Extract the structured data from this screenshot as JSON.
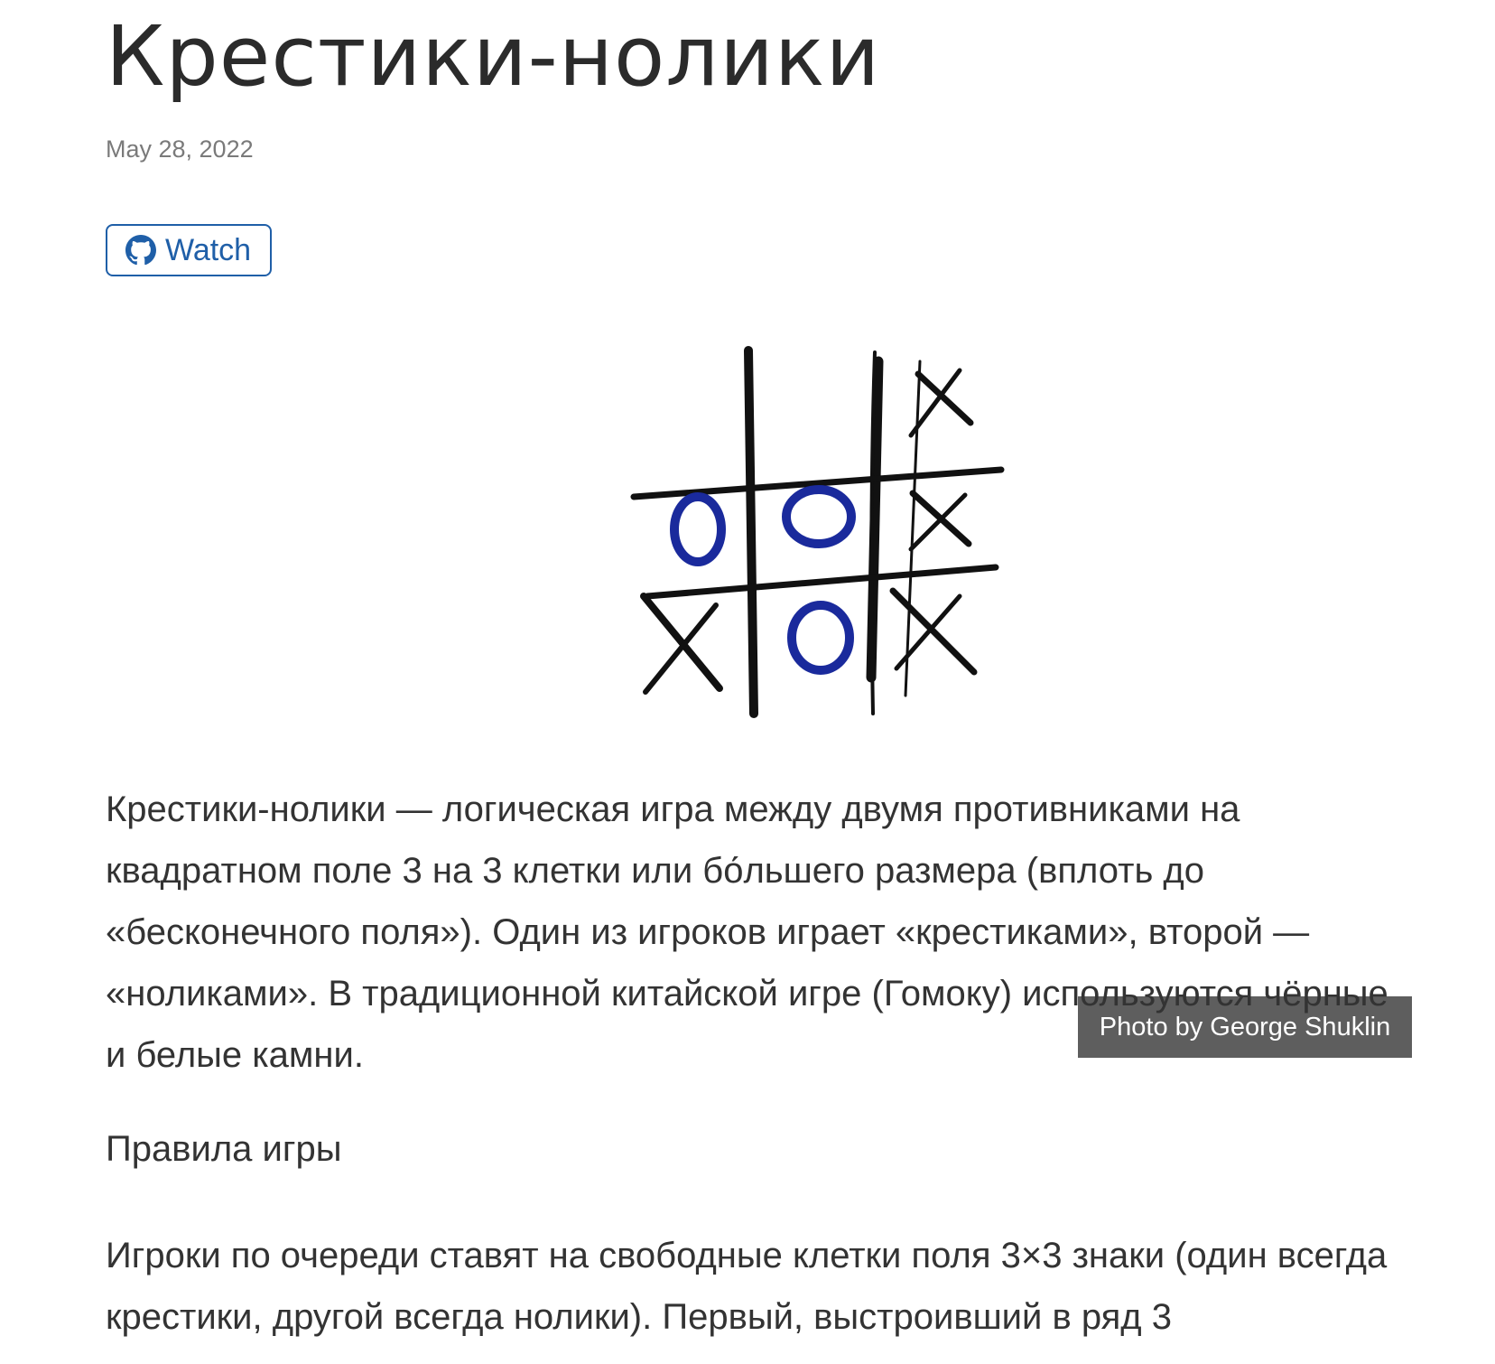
{
  "article": {
    "title": "Крестики-нолики",
    "date": "May 28, 2022",
    "watch_button": {
      "label": "Watch",
      "icon": "github-icon",
      "color": "#1f5fa8"
    },
    "image": {
      "credit": "Photo by George Shuklin",
      "o_color": "#1a2a9c"
    },
    "paragraph_1": "Крестики-нолики — логическая игра между двумя противниками на квадратном поле 3 на 3 клетки или бо́льшего размера (вплоть до «бесконечного поля»). Один из игроков играет «крестиками», второй — «ноликами». В традиционной китайской игре (Гомоку) используются чёрные и белые камни.",
    "section_heading": "Правила игры",
    "paragraph_2": "Игроки по очереди ставят на свободные клетки поля 3×3 знаки (один всегда крестики, другой всегда нолики). Первый, выстроивший в ряд 3"
  }
}
